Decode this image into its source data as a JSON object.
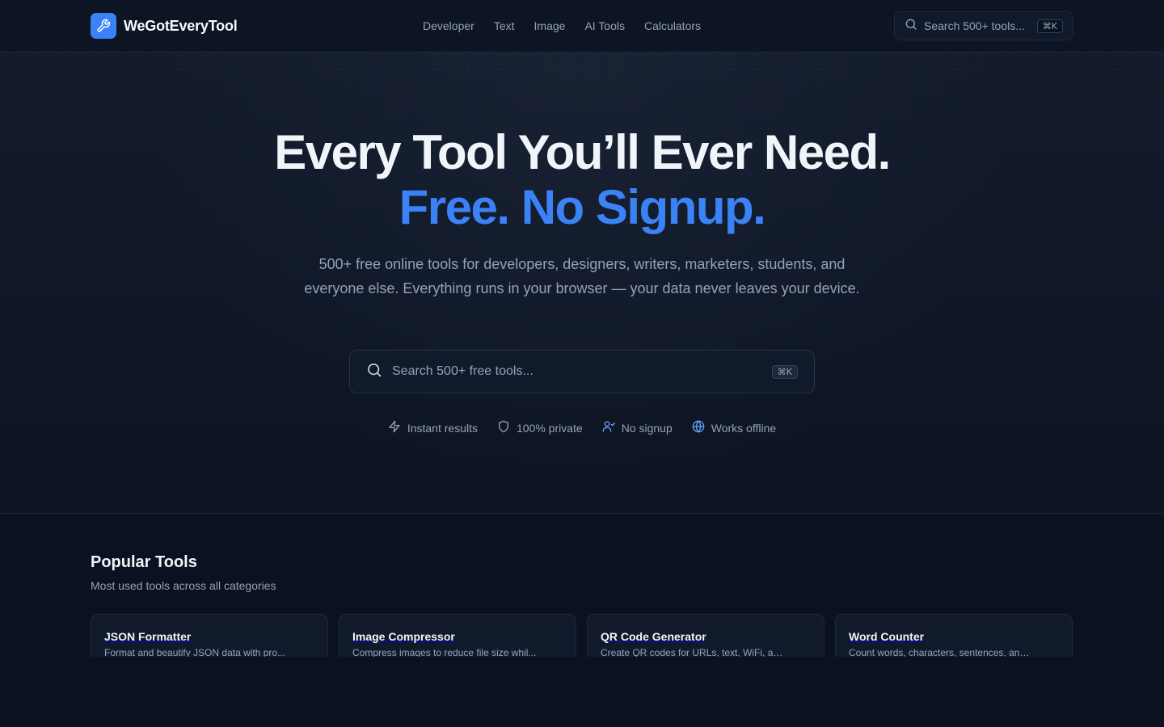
{
  "brand": {
    "name": "WeGotEveryTool",
    "icon": "wrench-icon",
    "accent": "#3b82f6"
  },
  "nav": {
    "links": [
      "Developer",
      "Text",
      "Image",
      "AI Tools",
      "Calculators"
    ],
    "search": {
      "placeholder": "Search 500+ tools...",
      "shortcut": "⌘K"
    }
  },
  "hero": {
    "title": "Every Tool You’ll Ever Need.",
    "title_accent": "Free. No Signup.",
    "description": "500+ free online tools for developers, designers, writers, marketers, students, and everyone else. Everything runs in your browser — your data never leaves your device.",
    "search": {
      "placeholder": "Search 500+ free tools...",
      "shortcut": "⌘K"
    },
    "features": [
      {
        "label": "Instant results",
        "icon": "zap-icon"
      },
      {
        "label": "100% private",
        "icon": "shield-icon"
      },
      {
        "label": "No signup",
        "icon": "user-check-icon"
      },
      {
        "label": "Works offline",
        "icon": "globe-icon"
      }
    ]
  },
  "popular": {
    "title": "Popular Tools",
    "subtitle": "Most used tools across all categories",
    "tools": [
      {
        "title": "JSON Formatter",
        "desc": "Format and beautify JSON data with pro..."
      },
      {
        "title": "Image Compressor",
        "desc": "Compress images to reduce file size whil..."
      },
      {
        "title": "QR Code Generator",
        "desc": "Create QR codes for URLs, text, WiFi, and..."
      },
      {
        "title": "Word Counter",
        "desc": "Count words, characters, sentences, and ..."
      }
    ]
  }
}
